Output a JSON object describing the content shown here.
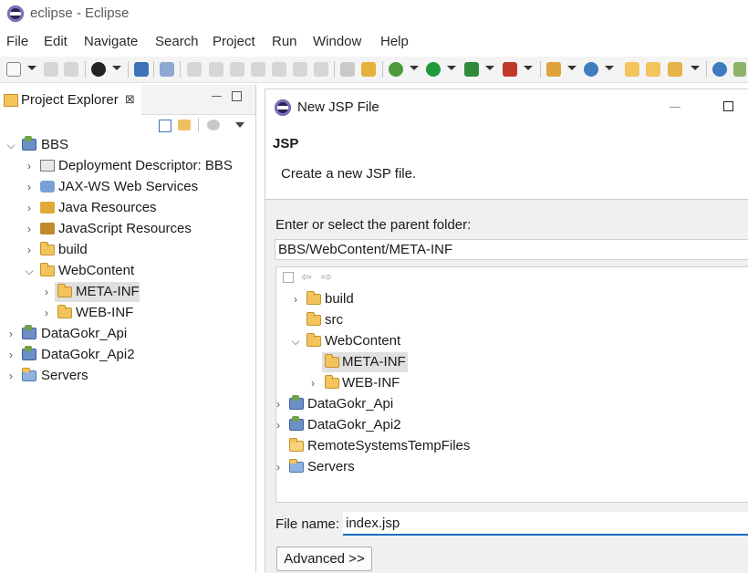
{
  "window": {
    "title": "eclipse - Eclipse"
  },
  "menubar": [
    "File",
    "Edit",
    "Navigate",
    "Search",
    "Project",
    "Run",
    "Window",
    "Help"
  ],
  "explorer": {
    "tab_label": "Project Explorer",
    "close_glyph": "⊠",
    "tree": [
      {
        "label": "BBS",
        "icon": "project-icon",
        "expanded": true
      },
      {
        "label": "Deployment Descriptor: BBS",
        "icon": "deployment-descriptor-icon"
      },
      {
        "label": "JAX-WS Web Services",
        "icon": "web-services-icon"
      },
      {
        "label": "Java Resources",
        "icon": "java-resources-icon"
      },
      {
        "label": "JavaScript Resources",
        "icon": "javascript-resources-icon"
      },
      {
        "label": "build",
        "icon": "folder-icon"
      },
      {
        "label": "WebContent",
        "icon": "folder-icon",
        "expanded": true
      },
      {
        "label": "META-INF",
        "icon": "folder-icon",
        "selected": true
      },
      {
        "label": "WEB-INF",
        "icon": "folder-icon"
      },
      {
        "label": "DataGokr_Api",
        "icon": "project-icon"
      },
      {
        "label": "DataGokr_Api2",
        "icon": "project-icon"
      },
      {
        "label": "Servers",
        "icon": "folder-icon"
      }
    ]
  },
  "dialog": {
    "title": "New JSP File",
    "heading": "JSP",
    "description": "Create a new JSP file.",
    "parent_folder_label": "Enter or select the parent folder:",
    "parent_folder_value": "BBS/WebContent/META-INF",
    "folder_tree": [
      {
        "label": "build"
      },
      {
        "label": "src"
      },
      {
        "label": "WebContent"
      },
      {
        "label": "META-INF"
      },
      {
        "label": "WEB-INF"
      },
      {
        "label": "DataGokr_Api"
      },
      {
        "label": "DataGokr_Api2"
      },
      {
        "label": "RemoteSystemsTempFiles"
      },
      {
        "label": "Servers"
      }
    ],
    "file_name_label": "File name:",
    "file_name_value": "index.jsp",
    "advanced_label": "Advanced >>"
  },
  "colors": {
    "selection": "#e0e0e0",
    "focus_underline": "#1b6fc2",
    "folder": "#f3c45c"
  }
}
